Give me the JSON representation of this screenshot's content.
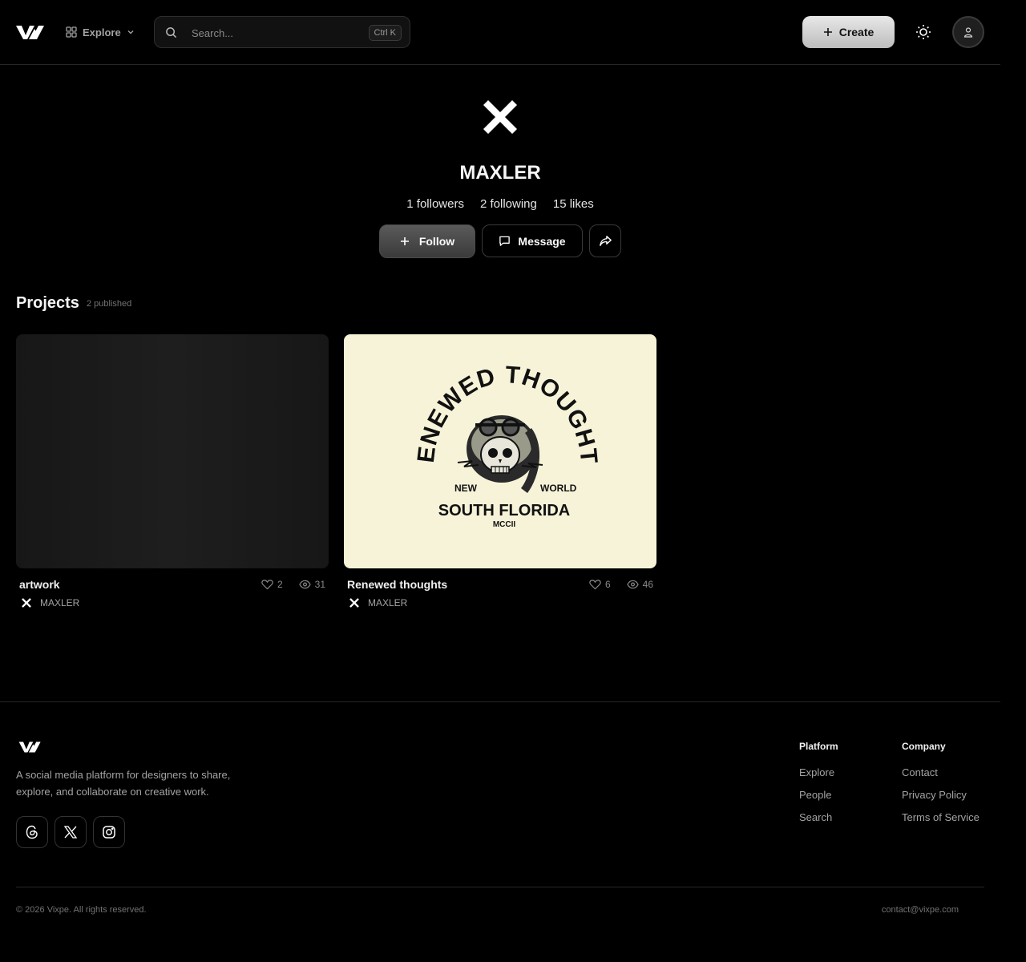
{
  "header": {
    "explore_label": "Explore",
    "search_placeholder": "Search...",
    "search_shortcut": "Ctrl K",
    "create_label": "Create"
  },
  "profile": {
    "name": "MAXLER",
    "followers": "1 followers",
    "following": "2 following",
    "likes": "15 likes",
    "follow_label": "Follow",
    "message_label": "Message"
  },
  "projects": {
    "title": "Projects",
    "count": "2 published",
    "items": [
      {
        "title": "artwork",
        "likes": "2",
        "views": "31",
        "author": "MAXLER"
      },
      {
        "title": "Renewed thoughts",
        "likes": "6",
        "views": "46",
        "author": "MAXLER",
        "artwork_text": {
          "arc": "RENEWED THOUGHTS",
          "left": "NEW",
          "right": "WORLD",
          "main": "SOUTH FLORIDA",
          "sub": "MCCII"
        }
      }
    ]
  },
  "footer": {
    "tagline": "A social media platform for designers to share, explore, and collaborate on creative work.",
    "platform_heading": "Platform",
    "platform_links": [
      "Explore",
      "People",
      "Search"
    ],
    "company_heading": "Company",
    "company_links": [
      "Contact",
      "Privacy Policy",
      "Terms of Service"
    ],
    "copyright": "© 2026 Vixpe. All rights reserved.",
    "contact_email": "contact@vixpe.com",
    "socials": [
      "threads-icon",
      "x-icon",
      "instagram-icon"
    ]
  },
  "colors": {
    "background": "#000000",
    "artwork_bg": "#f6f3d8",
    "accent": "#e8e8e8"
  }
}
